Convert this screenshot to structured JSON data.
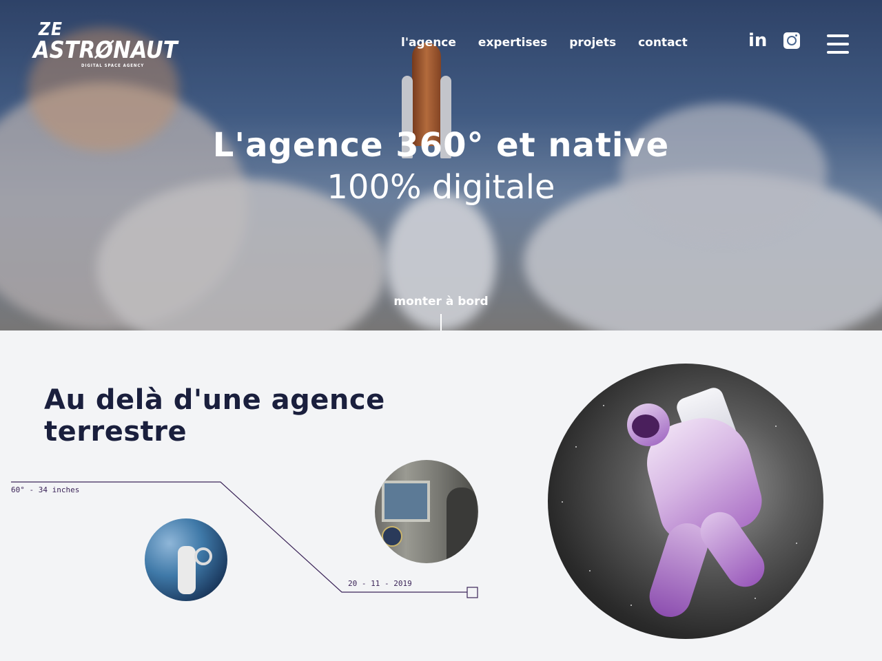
{
  "header": {
    "logo": {
      "line1": "ZE",
      "line2": "ASTRØNAUT",
      "tagline": "DIGITAL SPACE AGENCY"
    },
    "nav": [
      {
        "label": "l'agence"
      },
      {
        "label": "expertises"
      },
      {
        "label": "projets"
      },
      {
        "label": "contact"
      }
    ],
    "social": {
      "linkedin_label": "in",
      "linkedin_icon": "linkedin-icon",
      "instagram_icon": "instagram-icon"
    },
    "menu_icon": "hamburger-menu-icon"
  },
  "hero": {
    "title_line1": "L'agence 360° et native",
    "title_line2": "100% digitale",
    "cta": "monter à bord"
  },
  "section": {
    "title_line1": "Au delà d'une agence",
    "title_line2": "terrestre",
    "timeline_label_left": "60° - 34 inches",
    "timeline_label_right": "20 - 11 - 2019"
  },
  "colors": {
    "dark_text": "#1a1f3d",
    "timeline_line": "#3b2458",
    "background": "#f3f4f6"
  }
}
